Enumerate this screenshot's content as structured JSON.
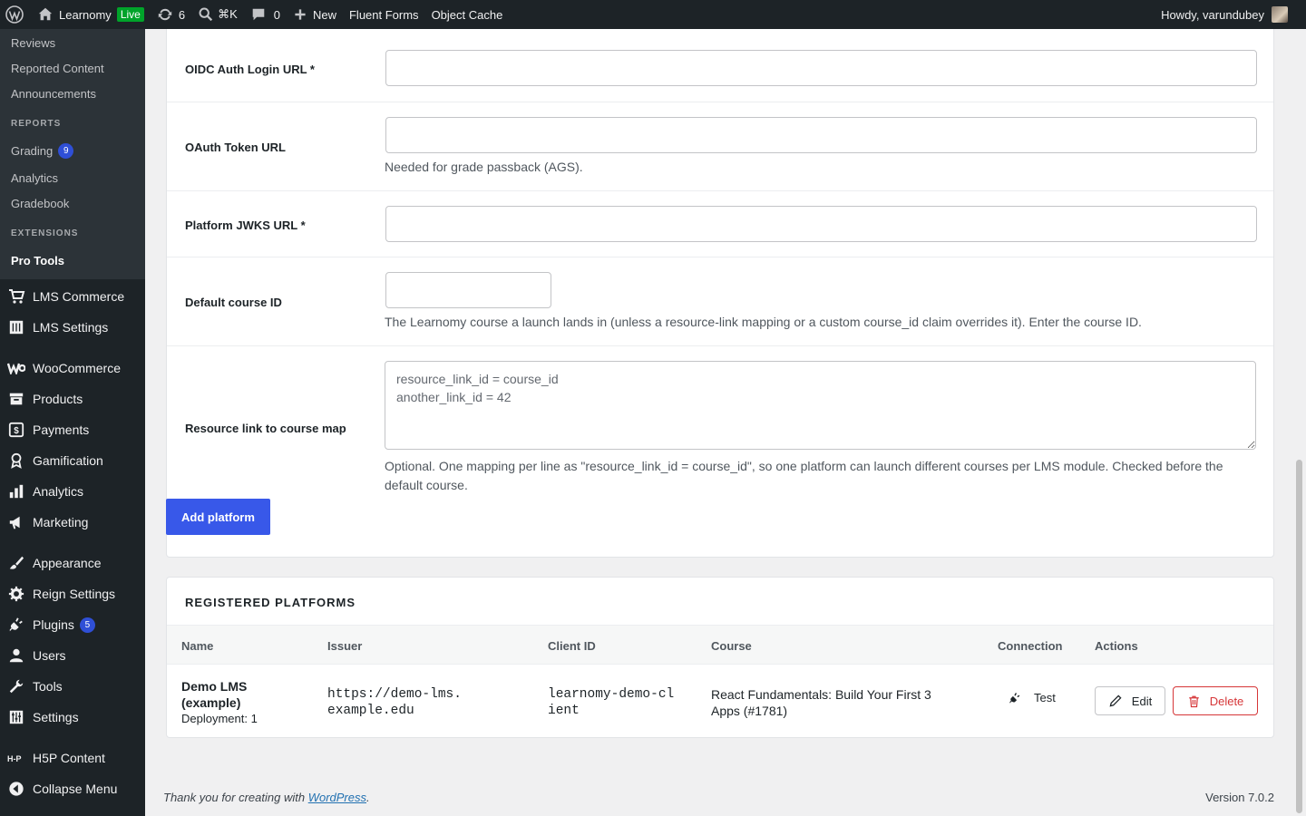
{
  "adminbar": {
    "site_name": "Learnomy",
    "live_badge": "Live",
    "updates_count": "6",
    "search_shortcut": "⌘K",
    "comments_count": "0",
    "new_label": "New",
    "fluent_forms": "Fluent Forms",
    "object_cache": "Object Cache",
    "howdy": "Howdy, varundubey"
  },
  "sidebar": {
    "submenu": {
      "reviews": "Reviews",
      "reported_content": "Reported Content",
      "announcements": "Announcements",
      "reports_heading": "REPORTS",
      "grading": "Grading",
      "grading_badge": "9",
      "analytics": "Analytics",
      "gradebook": "Gradebook",
      "extensions_heading": "EXTENSIONS",
      "pro_tools": "Pro Tools"
    },
    "menu": {
      "lms_commerce": "LMS Commerce",
      "lms_settings": "LMS Settings",
      "woocommerce": "WooCommerce",
      "products": "Products",
      "payments": "Payments",
      "gamification": "Gamification",
      "analytics": "Analytics",
      "marketing": "Marketing",
      "appearance": "Appearance",
      "reign_settings": "Reign Settings",
      "plugins": "Plugins",
      "plugins_badge": "5",
      "users": "Users",
      "tools": "Tools",
      "settings": "Settings",
      "h5p_content": "H5P Content",
      "collapse_menu": "Collapse Menu"
    }
  },
  "form": {
    "oidc_label": "OIDC Auth Login URL *",
    "oauth_label": "OAuth Token URL",
    "oauth_help": "Needed for grade passback (AGS).",
    "jwks_label": "Platform JWKS URL *",
    "course_label": "Default course ID",
    "course_help": "The Learnomy course a launch lands in (unless a resource-link mapping or a custom course_id claim overrides it). Enter the course ID.",
    "map_label": "Resource link to course map",
    "map_placeholder": "resource_link_id = course_id\nanother_link_id = 42",
    "map_help": "Optional. One mapping per line as \"resource_link_id = course_id\", so one platform can launch different courses per LMS module. Checked before the default course.",
    "add_button": "Add platform"
  },
  "platforms": {
    "heading": "REGISTERED PLATFORMS",
    "columns": [
      "Name",
      "Issuer",
      "Client ID",
      "Course",
      "Connection",
      "Actions"
    ],
    "rows": [
      {
        "name": "Demo LMS (example)",
        "deployment": "Deployment: 1",
        "issuer": "https://demo-lms.example.edu",
        "client_id": "learnomy-demo-client",
        "course": "React Fundamentals: Build Your First 3 Apps (#1781)",
        "test_label": "Test",
        "edit_label": "Edit",
        "delete_label": "Delete"
      }
    ]
  },
  "footer": {
    "thanks_prefix": "Thank you for creating with ",
    "wordpress_link": "WordPress",
    "thanks_suffix": ".",
    "version": "Version 7.0.2"
  },
  "colors": {
    "primary": "#3858e9",
    "danger": "#d63638",
    "adminbar": "#1d2327",
    "live": "#00a32a"
  }
}
